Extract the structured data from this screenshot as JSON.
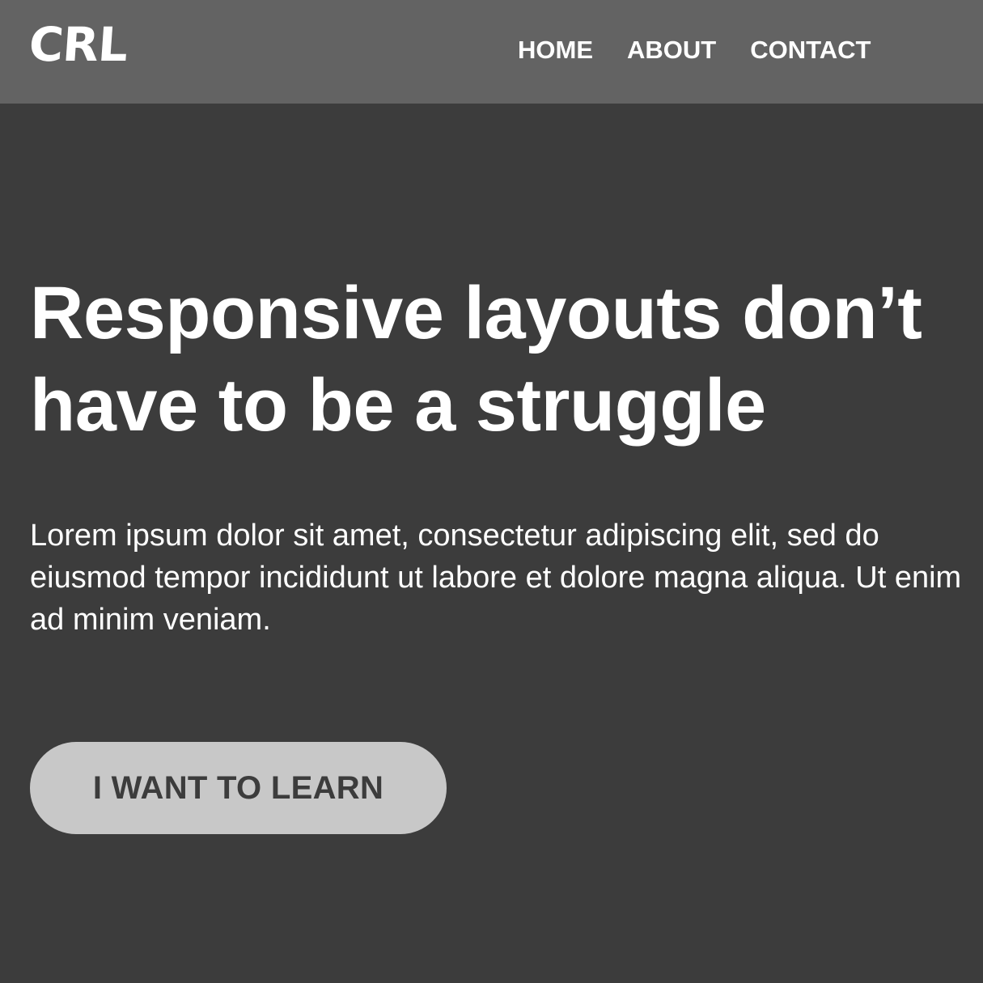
{
  "header": {
    "logo_text": "CRL",
    "nav": [
      {
        "label": "HOME"
      },
      {
        "label": "ABOUT"
      },
      {
        "label": "CONTACT"
      }
    ]
  },
  "hero": {
    "headline": "Responsive layouts don’t have to be a struggle",
    "body": "Lorem ipsum dolor sit amet, consectetur adipiscing elit, sed do eiusmod tempor incididunt ut labore et dolore magna aliqua. Ut enim ad minim veniam.",
    "cta_label": "I WANT TO LEARN"
  },
  "colors": {
    "header_bg": "#636363",
    "page_bg": "#3c3c3c",
    "button_bg": "#c8c8c8",
    "text": "#ffffff",
    "button_text": "#3c3c3c"
  }
}
